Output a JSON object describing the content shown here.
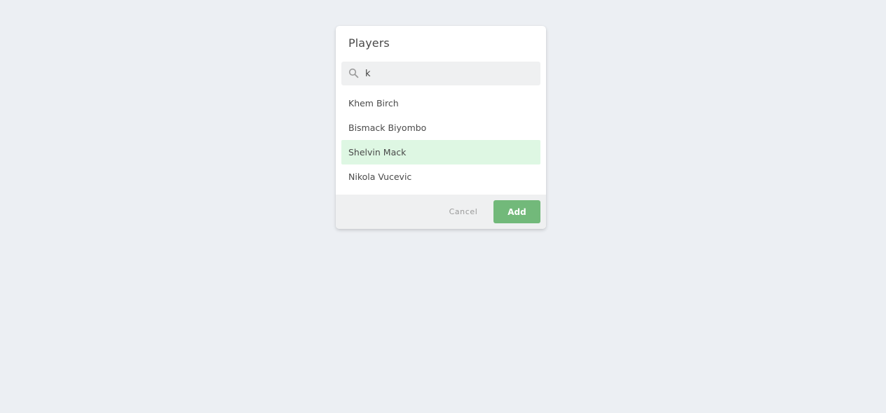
{
  "dialog": {
    "title": "Players"
  },
  "search": {
    "value": "k",
    "placeholder": ""
  },
  "players": [
    {
      "name": "Khem Birch",
      "selected": false
    },
    {
      "name": "Bismack Biyombo",
      "selected": false
    },
    {
      "name": "Shelvin Mack",
      "selected": true
    },
    {
      "name": "Nikola Vucevic",
      "selected": false
    }
  ],
  "footer": {
    "cancel_label": "Cancel",
    "add_label": "Add"
  },
  "colors": {
    "background": "#eceff3",
    "selected_row": "#def7e3",
    "add_button": "#72b97a"
  },
  "icons": {
    "search": "search-icon"
  }
}
